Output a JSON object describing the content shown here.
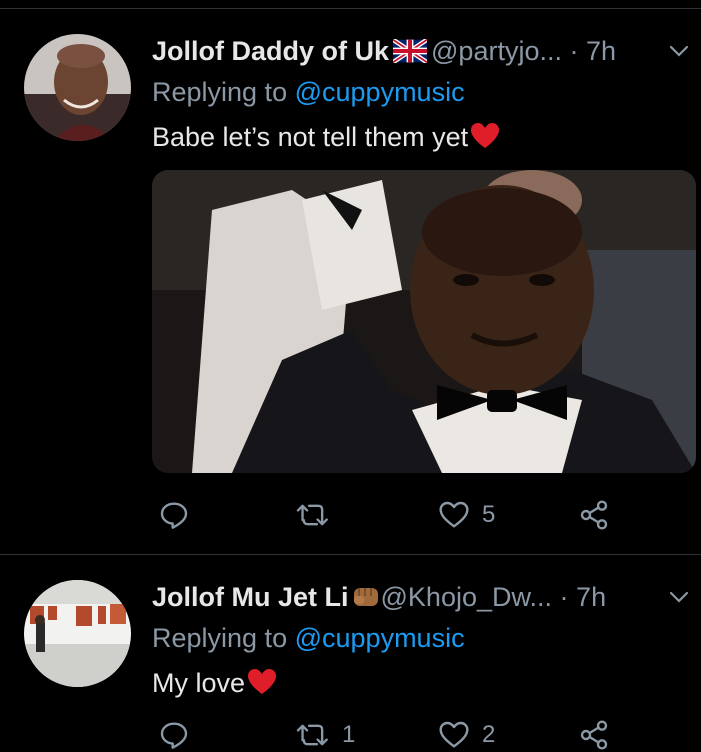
{
  "tweets": [
    {
      "name": "Jollof Daddy of Uk",
      "name_emoji": "uk-flag",
      "handle": "@partyjo...",
      "dot": "·",
      "time": "7h",
      "reply_prefix": "Replying to",
      "reply_to": "@cuppymusic",
      "text": "Babe let’s not tell them yet",
      "text_emoji": "red-heart",
      "has_media": true,
      "retweets": "",
      "likes": "5"
    },
    {
      "name": "Jollof Mu Jet Li",
      "name_emoji": "fist",
      "handle": "@Khojo_Dw...",
      "dot": "·",
      "time": "7h",
      "reply_prefix": "Replying to",
      "reply_to": "@cuppymusic",
      "text": "My love",
      "text_emoji": "red-heart",
      "has_media": false,
      "retweets": "1",
      "likes": "2"
    }
  ],
  "colors": {
    "mention": "#1d9bf0",
    "muted": "#8b98a5",
    "text": "#e7e7e7",
    "background": "#000000",
    "heart": "#e0245e"
  }
}
